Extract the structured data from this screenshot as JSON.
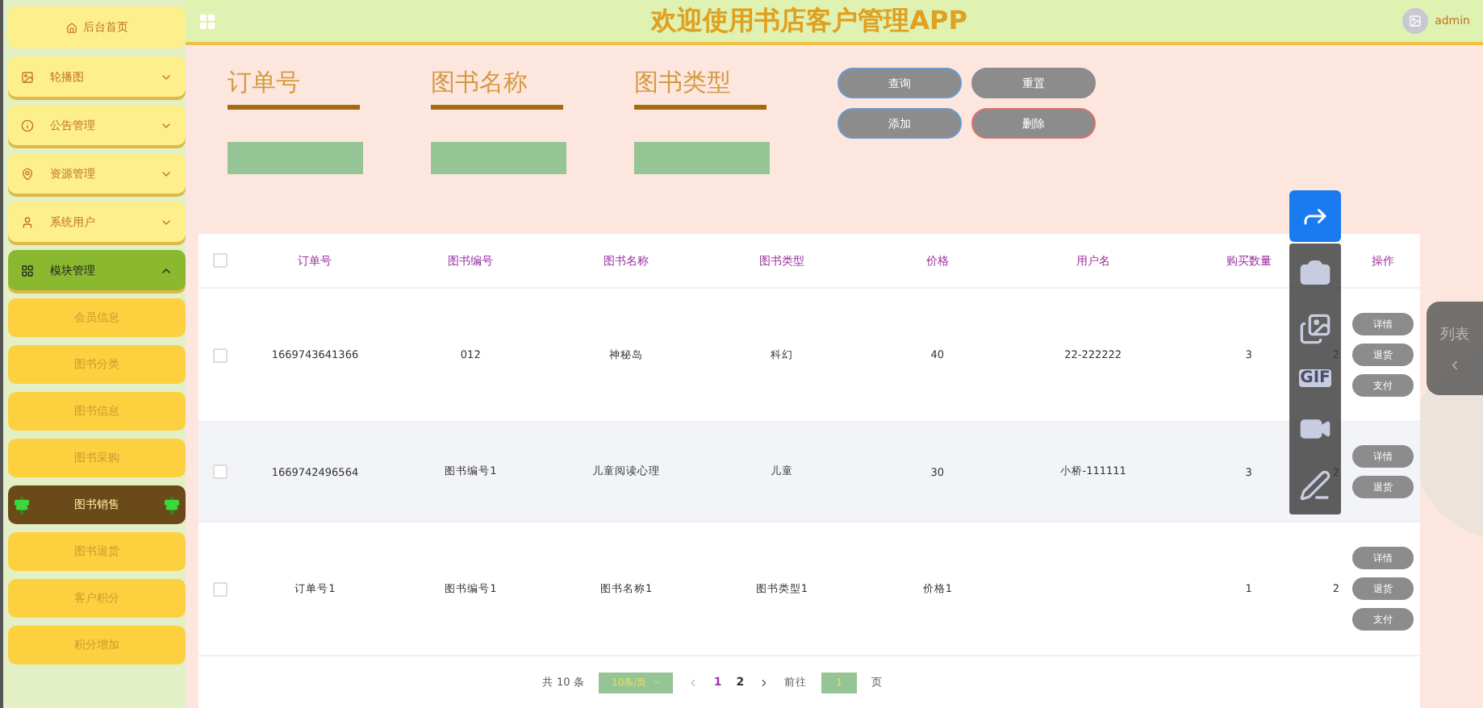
{
  "sidebar": {
    "home": "后台首页",
    "items": [
      {
        "label": "轮播图",
        "expanded": false
      },
      {
        "label": "公告管理",
        "expanded": false
      },
      {
        "label": "资源管理",
        "expanded": false
      },
      {
        "label": "系统用户",
        "expanded": false
      },
      {
        "label": "模块管理",
        "expanded": true,
        "children": [
          {
            "label": "会员信息",
            "selected": false
          },
          {
            "label": "图书分类",
            "selected": false
          },
          {
            "label": "图书信息",
            "selected": false
          },
          {
            "label": "图书采购",
            "selected": false
          },
          {
            "label": "图书销售",
            "selected": true
          },
          {
            "label": "图书退货",
            "selected": false
          },
          {
            "label": "客户积分",
            "selected": false
          },
          {
            "label": "积分增加",
            "selected": false
          }
        ]
      }
    ]
  },
  "header": {
    "title": "欢迎使用书店客户管理APP",
    "user": "admin"
  },
  "search": {
    "fields": [
      {
        "label": "订单号"
      },
      {
        "label": "图书名称"
      },
      {
        "label": "图书类型"
      }
    ],
    "buttons": [
      {
        "label": "查询",
        "kind": "normal"
      },
      {
        "label": "重置",
        "kind": "plain"
      },
      {
        "label": "添加",
        "kind": "normal"
      },
      {
        "label": "删除",
        "kind": "danger"
      }
    ]
  },
  "table": {
    "select_all": {
      "checked": false
    },
    "columns": [
      "订单号",
      "图书编号",
      "图书名称",
      "图书类型",
      "价格",
      "用户名",
      "购买数量",
      "操作"
    ],
    "rows": [
      {
        "cells": [
          "1669743641366",
          "012",
          "神秘岛",
          "科幻",
          "40",
          "22-222222",
          "3",
          "2"
        ],
        "actions": [
          "详情",
          "退货",
          "支付"
        ],
        "checked": false
      },
      {
        "cells": [
          "1669742496564",
          "图书编号1",
          "儿童阅读心理",
          "儿童",
          "30",
          "小桥-111111",
          "3",
          "2"
        ],
        "actions": [
          "详情",
          "退货"
        ],
        "checked": false
      },
      {
        "cells": [
          "订单号1",
          "图书编号1",
          "图书名称1",
          "图书类型1",
          "价格1",
          "",
          "1",
          "2"
        ],
        "actions": [
          "详情",
          "退货",
          "支付"
        ],
        "checked": false
      }
    ]
  },
  "pagination": {
    "total": "共 10 条",
    "page_size": "10条/页",
    "pages": [
      {
        "label": "1",
        "selected": true
      },
      {
        "label": "2",
        "selected": false
      }
    ],
    "goto": "前往",
    "goto_value": "1",
    "page_unit": "页"
  },
  "capture_toolbar": {
    "gif_label": "GIF"
  },
  "side_tab": {
    "label": "列表"
  }
}
